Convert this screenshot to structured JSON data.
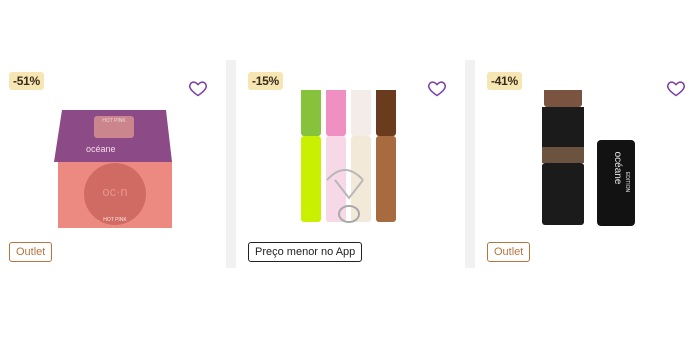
{
  "products": [
    {
      "discount": "-51%",
      "tag": "Outlet",
      "image_icon": "blush-compact",
      "packaging_text": {
        "brand": "océane",
        "pan_text": "oc·n",
        "shade_top": "HOT PINK",
        "shade_bottom": "HOT PINK"
      }
    },
    {
      "discount": "-15%",
      "tag": "Preço menor no App",
      "image_icon": "lip-gloss-kit"
    },
    {
      "discount": "-41%",
      "tag": "Outlet",
      "image_icon": "contour-stick",
      "packaging_text": {
        "brand": "océane",
        "line": "EDITION"
      }
    }
  ],
  "colors": {
    "badge_bg": "#f5e6b3",
    "heart": "#7b3fa6",
    "outlet": "#b8743c"
  }
}
